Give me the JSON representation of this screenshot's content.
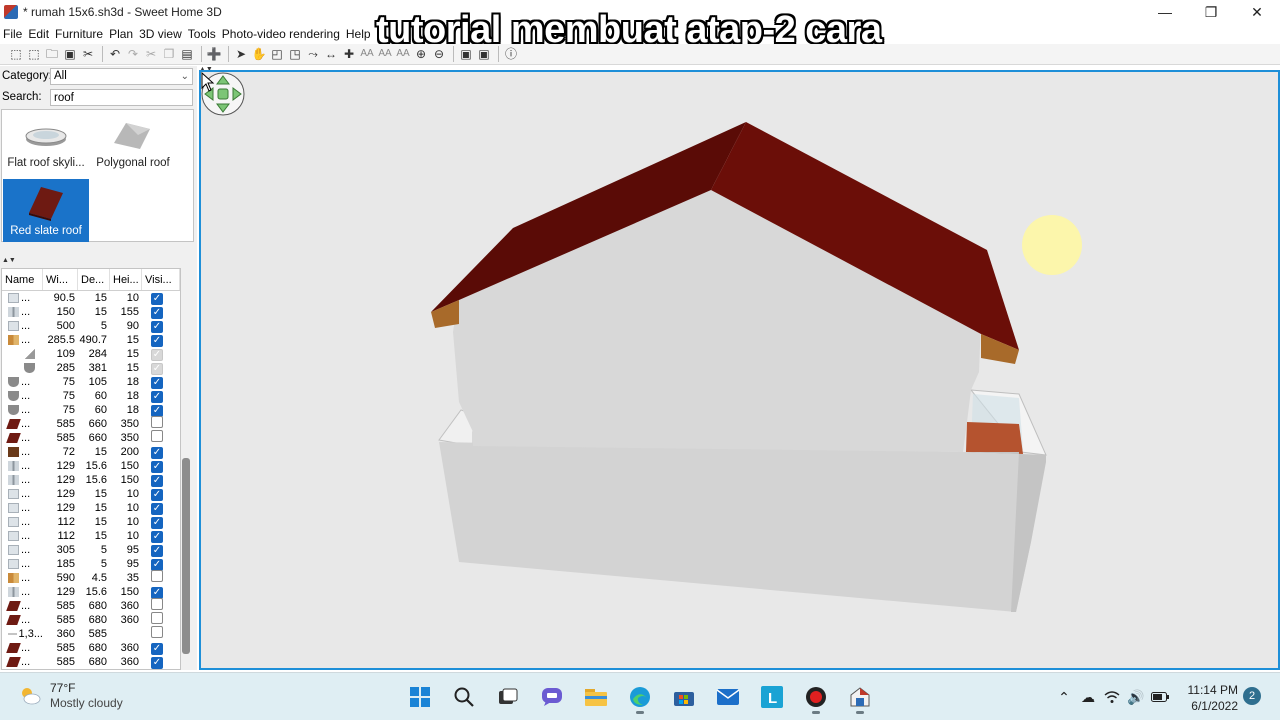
{
  "window": {
    "title": "* rumah 15x6.sh3d - Sweet Home 3D",
    "caption_overlay": "tutorial membuat atap-2 cara"
  },
  "menu": [
    "File",
    "Edit",
    "Furniture",
    "Plan",
    "3D view",
    "Tools",
    "Photo-video rendering",
    "Help"
  ],
  "toolbar_icons": [
    "new-home-icon",
    "new-from-demo-icon",
    "open-icon",
    "save-icon",
    "cut-icon",
    "undo-icon",
    "redo-icon",
    "cut-icon",
    "copy-icon",
    "paste-icon",
    "paste-style-icon",
    "add-furniture-icon",
    "select-mode-icon",
    "pan-mode-icon",
    "create-walls-icon",
    "create-rooms-icon",
    "create-polylines-icon",
    "create-dimensions-icon",
    "create-labels-icon",
    "increase-text-icon",
    "decrease-text-icon",
    "bold-icon",
    "italic-icon",
    "zoom-in-icon",
    "zoom-out-icon",
    "create-photo-icon",
    "create-video-icon",
    "help-icon"
  ],
  "catalog": {
    "category_label": "Category:",
    "category_value": "All",
    "search_label": "Search:",
    "search_value": "roof",
    "items": [
      {
        "label": "Flat roof skyli...",
        "selected": false
      },
      {
        "label": "Polygonal roof",
        "selected": false
      },
      {
        "label": "Red slate roof",
        "selected": true
      }
    ]
  },
  "furniture_table": {
    "columns": [
      "Name",
      "Wi...",
      "De...",
      "Hei...",
      "Visi..."
    ],
    "rows": [
      {
        "name": "...",
        "w": "90.5",
        "d": "15",
        "h": "10",
        "visible": "on",
        "icon": "plain"
      },
      {
        "name": "...",
        "w": "150",
        "d": "15",
        "h": "155",
        "visible": "on",
        "icon": "window"
      },
      {
        "name": "...",
        "w": "500",
        "d": "5",
        "h": "90",
        "visible": "on",
        "icon": "plain"
      },
      {
        "name": "...",
        "w": "285.5",
        "d": "490.7",
        "h": "15",
        "visible": "on",
        "icon": "group"
      },
      {
        "name": "",
        "w": "109",
        "d": "284",
        "h": "15",
        "visible": "dim",
        "icon": "stair"
      },
      {
        "name": "",
        "w": "285",
        "d": "381",
        "h": "15",
        "visible": "dim",
        "icon": "bowl"
      },
      {
        "name": "...",
        "w": "75",
        "d": "105",
        "h": "18",
        "visible": "on",
        "icon": "bowl"
      },
      {
        "name": "...",
        "w": "75",
        "d": "60",
        "h": "18",
        "visible": "on",
        "icon": "bowl"
      },
      {
        "name": "...",
        "w": "75",
        "d": "60",
        "h": "18",
        "visible": "on",
        "icon": "bowl"
      },
      {
        "name": "...",
        "w": "585",
        "d": "660",
        "h": "350",
        "visible": "off",
        "icon": "roof"
      },
      {
        "name": "...",
        "w": "585",
        "d": "660",
        "h": "350",
        "visible": "off",
        "icon": "roof"
      },
      {
        "name": "...",
        "w": "72",
        "d": "15",
        "h": "200",
        "visible": "on",
        "icon": "door"
      },
      {
        "name": "...",
        "w": "129",
        "d": "15.6",
        "h": "150",
        "visible": "on",
        "icon": "window"
      },
      {
        "name": "...",
        "w": "129",
        "d": "15.6",
        "h": "150",
        "visible": "on",
        "icon": "window"
      },
      {
        "name": "...",
        "w": "129",
        "d": "15",
        "h": "10",
        "visible": "on",
        "icon": "plain"
      },
      {
        "name": "...",
        "w": "129",
        "d": "15",
        "h": "10",
        "visible": "on",
        "icon": "plain"
      },
      {
        "name": "...",
        "w": "112",
        "d": "15",
        "h": "10",
        "visible": "on",
        "icon": "plain"
      },
      {
        "name": "...",
        "w": "112",
        "d": "15",
        "h": "10",
        "visible": "on",
        "icon": "plain"
      },
      {
        "name": "...",
        "w": "305",
        "d": "5",
        "h": "95",
        "visible": "on",
        "icon": "plain"
      },
      {
        "name": "...",
        "w": "185",
        "d": "5",
        "h": "95",
        "visible": "on",
        "icon": "plain"
      },
      {
        "name": "...",
        "w": "590",
        "d": "4.5",
        "h": "35",
        "visible": "off",
        "icon": "group"
      },
      {
        "name": "...",
        "w": "129",
        "d": "15.6",
        "h": "150",
        "visible": "on",
        "icon": "window"
      },
      {
        "name": "...",
        "w": "585",
        "d": "680",
        "h": "360",
        "visible": "off",
        "icon": "roof"
      },
      {
        "name": "...",
        "w": "585",
        "d": "680",
        "h": "360",
        "visible": "off",
        "icon": "roof"
      },
      {
        "name": "1,3...",
        "w": "360",
        "d": "585",
        "h": "",
        "visible": "off",
        "icon": "line"
      },
      {
        "name": "...",
        "w": "585",
        "d": "680",
        "h": "360",
        "visible": "on",
        "icon": "roof"
      },
      {
        "name": "...",
        "w": "585",
        "d": "680",
        "h": "360",
        "visible": "on",
        "icon": "roof"
      }
    ]
  },
  "colors": {
    "roof": "#6b0e08",
    "accent_blue": "#1a73c9",
    "view_border": "#1e8fd8",
    "taskbar_bg": "#dfeef3"
  },
  "taskbar": {
    "weather_temp": "77°F",
    "weather_desc": "Mostly cloudy",
    "apps": [
      "start-icon",
      "search-icon",
      "task-view-icon",
      "chat-icon",
      "file-explorer-icon",
      "edge-icon",
      "store-icon",
      "mail-icon",
      "l-app-icon",
      "recorder-icon",
      "sweet-home-3d-icon"
    ],
    "time": "11:14 PM",
    "date": "6/1/2022",
    "notification_count": "2"
  }
}
